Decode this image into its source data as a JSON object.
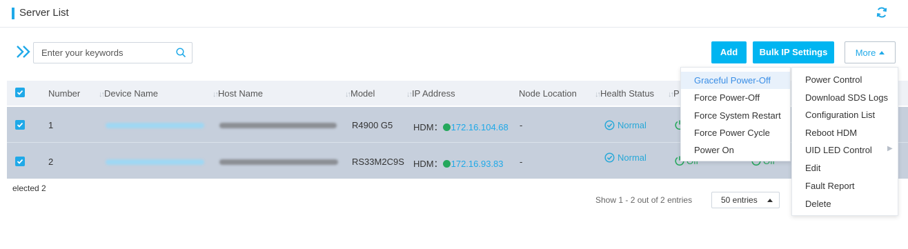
{
  "header": {
    "title": "Server List",
    "refresh_icon": "refresh-icon"
  },
  "toolbar": {
    "search_placeholder": "Enter your keywords",
    "add_label": "Add",
    "bulk_ip_label": "Bulk IP Settings",
    "more_label": "More",
    "accent_color": "#00b5f1"
  },
  "table": {
    "columns": [
      "Number",
      "Device Name",
      "Host Name",
      "Model",
      "IP Address",
      "Node Location",
      "Health Status",
      "P"
    ],
    "rows": [
      {
        "number": "1",
        "model": "R4900 G5",
        "ip_prefix": "HDM：",
        "ip": "172.16.104.68",
        "node_location": "-",
        "health": "Normal"
      },
      {
        "number": "2",
        "model": "RS33M2C9S",
        "ip_prefix": "HDM：",
        "ip": "172.16.93.83",
        "node_location": "-",
        "health": "Normal",
        "power": "Off"
      }
    ]
  },
  "footer": {
    "selected_text": "elected 2",
    "pager_text": "Show 1 - 2 out of 2 entries",
    "page_size": "50 entries"
  },
  "power_submenu": {
    "items": [
      "Graceful Power-Off",
      "Force Power-Off",
      "Force System Restart",
      "Force Power Cycle",
      "Power On"
    ],
    "active_index": 0
  },
  "more_menu": {
    "items": [
      "Power Control",
      "Download SDS Logs",
      "Configuration List",
      "Reboot HDM",
      "UID LED Control",
      "Edit",
      "Fault Report",
      "Delete"
    ]
  }
}
